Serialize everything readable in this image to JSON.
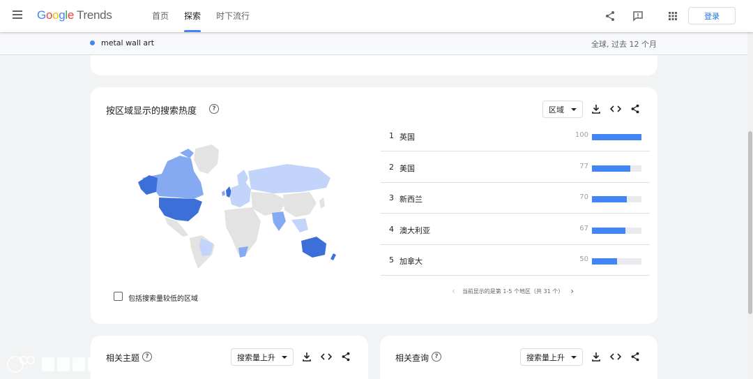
{
  "header": {
    "logo": {
      "g1": "G",
      "g2": "o",
      "g3": "o",
      "g4": "g",
      "g5": "l",
      "g6": "e",
      "product": "Trends"
    },
    "nav": [
      {
        "label": "首页",
        "active": false
      },
      {
        "label": "探索",
        "active": true
      },
      {
        "label": "时下流行",
        "active": false
      }
    ],
    "login_label": "登录",
    "icons": [
      "menu-icon",
      "share-icon",
      "feedback-icon",
      "apps-icon"
    ]
  },
  "term_bar": {
    "term": "metal wall art",
    "term_color": "#4285f4",
    "scope": "全球, 过去 12 个月"
  },
  "region_card": {
    "title": "按区域显示的搜索热度",
    "dropdown_value": "区域",
    "rows": [
      {
        "rank": "1",
        "name": "英国",
        "value": "100",
        "score": 100
      },
      {
        "rank": "2",
        "name": "美国",
        "value": "77",
        "score": 77
      },
      {
        "rank": "3",
        "name": "新西兰",
        "value": "70",
        "score": 70
      },
      {
        "rank": "4",
        "name": "澳大利亚",
        "value": "67",
        "score": 67
      },
      {
        "rank": "5",
        "name": "加拿大",
        "value": "50",
        "score": 50
      }
    ],
    "pagination": "当前显示的是第 1-5 个地区（共 31 个）",
    "include_low_label": "包括搜索量较低的区域",
    "colors": {
      "high": "#3c6fd8",
      "mid": "#86aaf2",
      "low": "#c3d4fb",
      "none": "#e3e3e3"
    }
  },
  "related_topics": {
    "title": "相关主题",
    "dropdown_value": "搜索量上升"
  },
  "related_queries": {
    "title": "相关查询",
    "dropdown_value": "搜索量上升"
  },
  "watermark": {
    "text": "大数跨境"
  }
}
